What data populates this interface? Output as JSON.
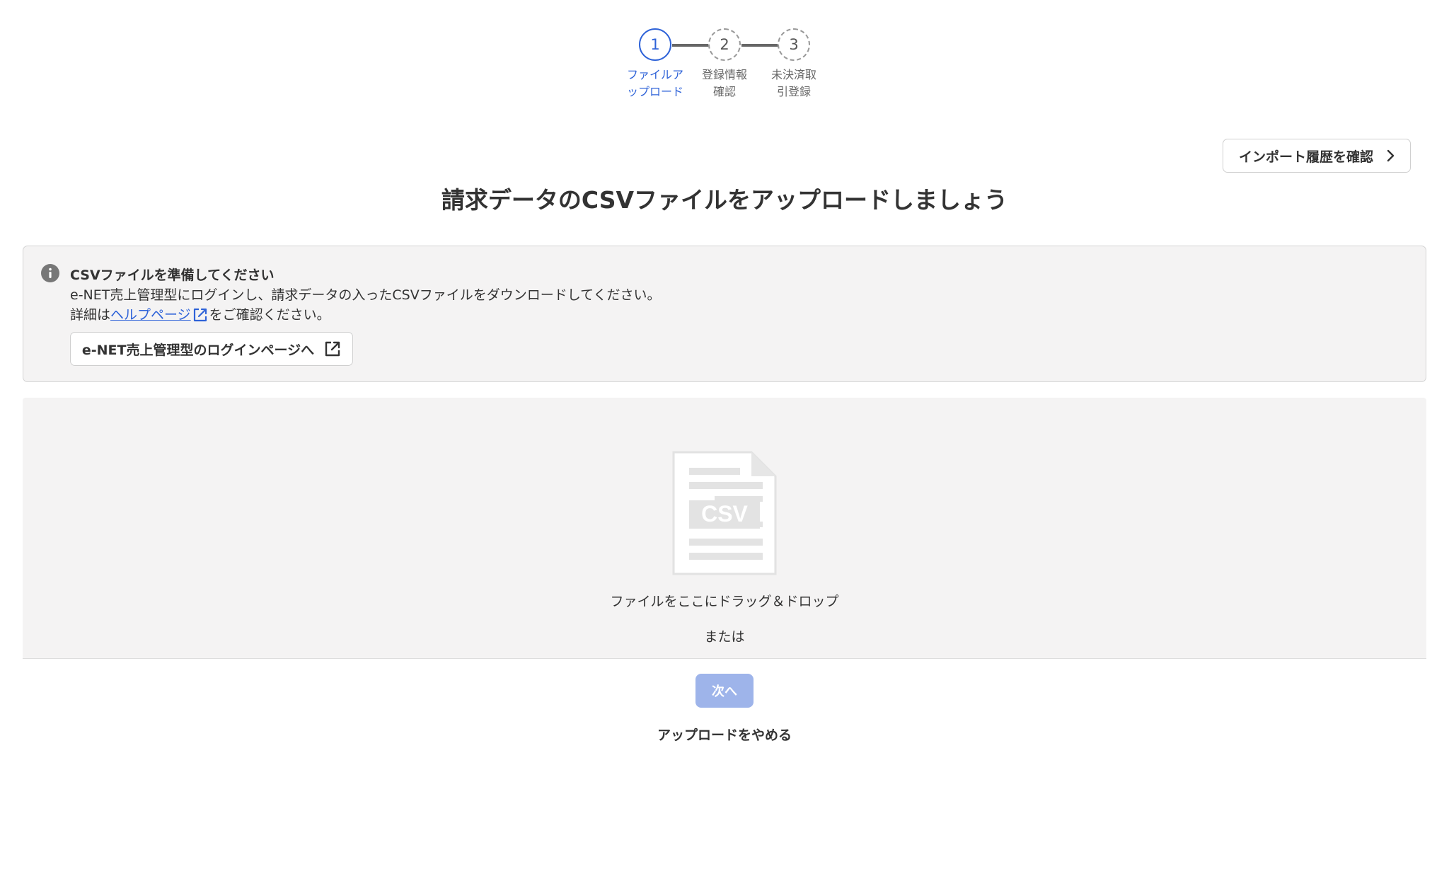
{
  "stepper": {
    "steps": [
      {
        "number": "1",
        "label": "ファイルアップロード",
        "state": "active"
      },
      {
        "number": "2",
        "label": "登録情報確認",
        "state": "pending"
      },
      {
        "number": "3",
        "label": "未決済取引登録",
        "state": "pending"
      }
    ]
  },
  "header": {
    "history_button_label": "インポート履歴を確認",
    "history_button_icon": "chevron-right-icon",
    "title": "請求データのCSVファイルをアップロードしましょう"
  },
  "info": {
    "icon": "info-icon",
    "title": "CSVファイルを準備してください",
    "line1": "e-NET売上管理型にログインし、請求データの入ったCSVファイルをダウンロードしてください。",
    "line2_prefix": "詳細は",
    "help_link_label": "ヘルプページ",
    "line2_suffix": "をご確認ください。",
    "login_button_label": "e-NET売上管理型のログインページへ",
    "login_button_icon": "external-link-icon"
  },
  "dropzone": {
    "icon": "csv-file-icon",
    "icon_text": "CSV",
    "drag_text": "ファイルをここにドラッグ＆ドロップ",
    "or_text": "または"
  },
  "actions": {
    "next_label": "次へ",
    "next_disabled": true,
    "cancel_label": "アップロードをやめる"
  },
  "colors": {
    "accent": "#2f63d8",
    "next_button_disabled": "#9eb4ea",
    "panel_background": "#f4f3f3"
  }
}
